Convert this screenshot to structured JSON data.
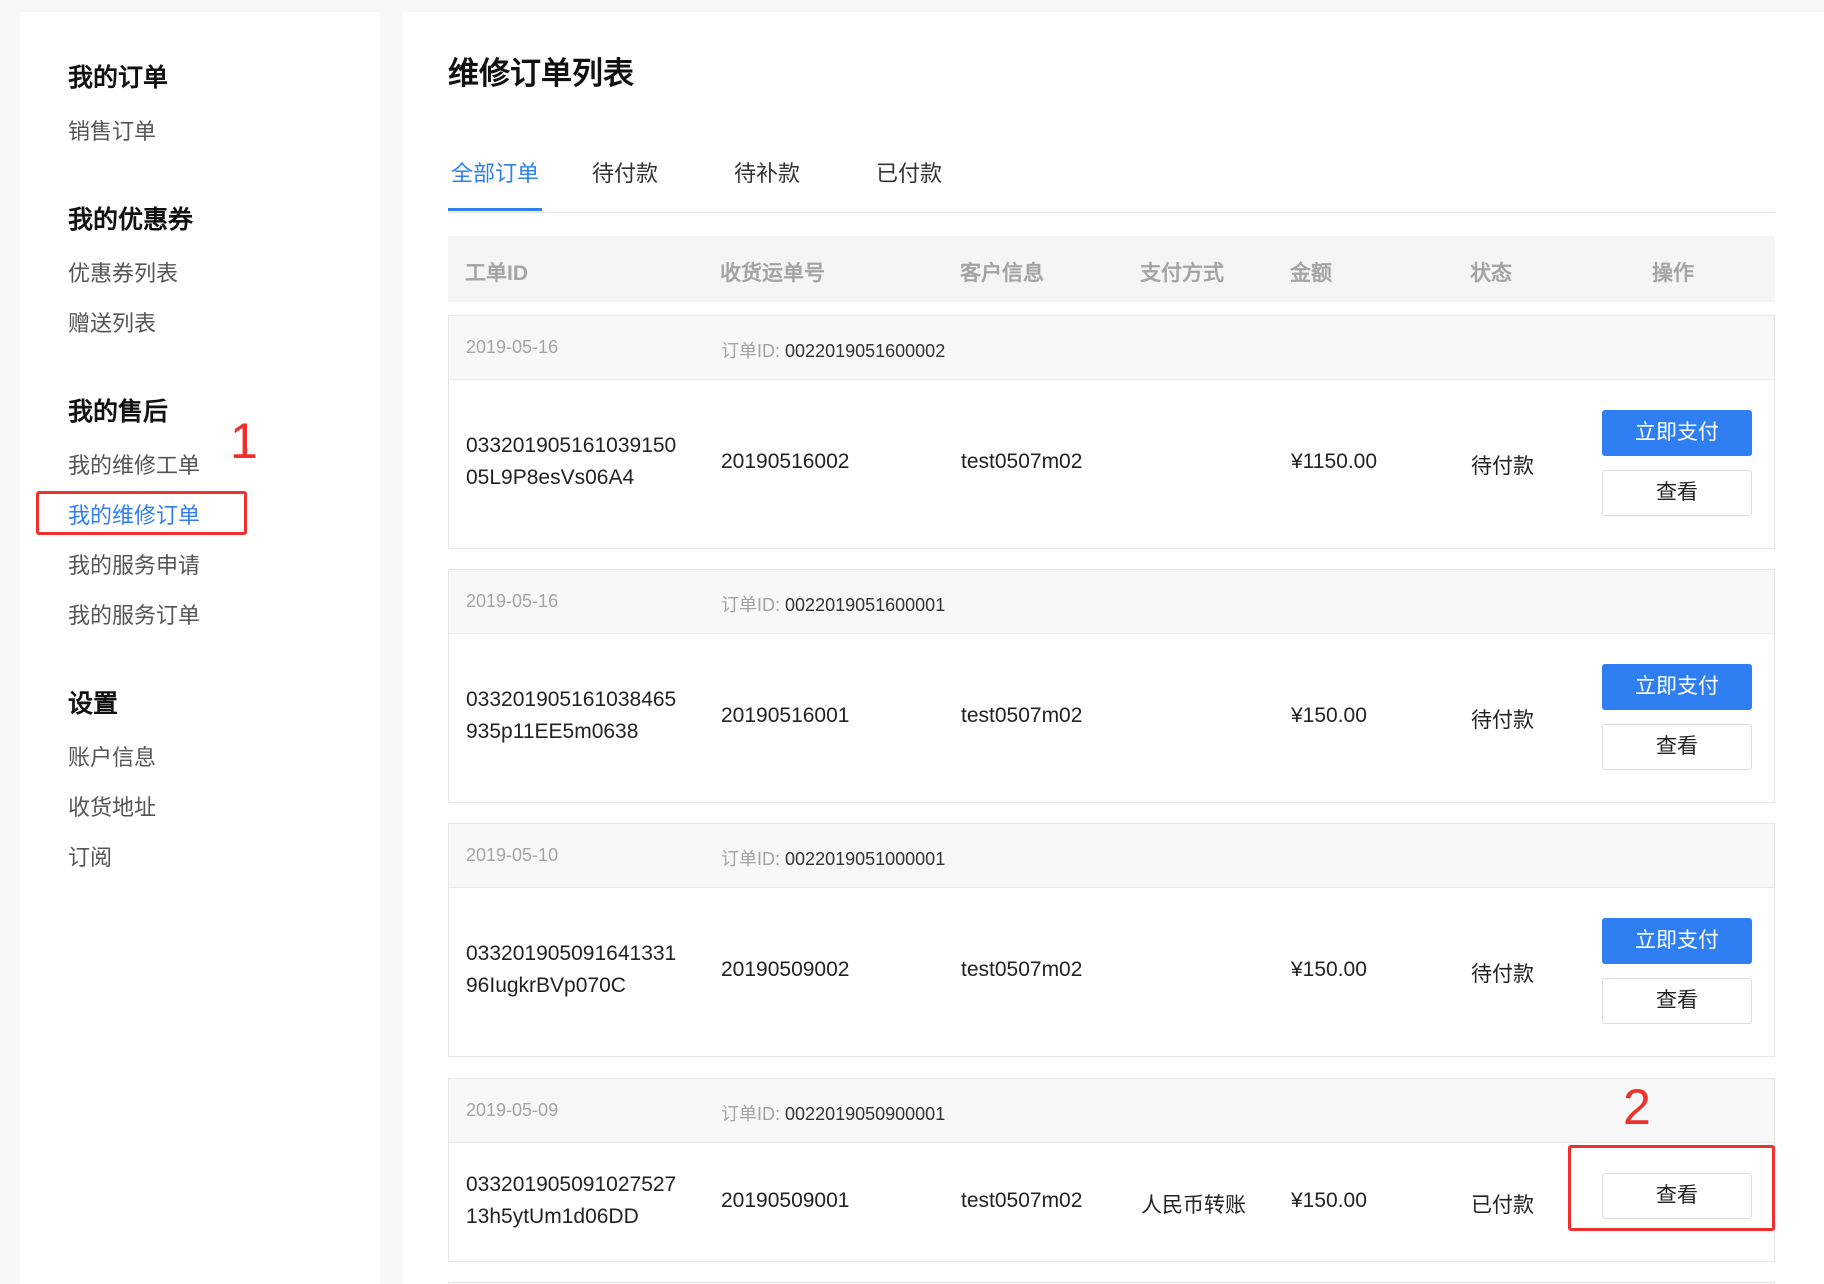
{
  "sidebar": {
    "groups": [
      {
        "title": "我的订单",
        "items": [
          "销售订单"
        ]
      },
      {
        "title": "我的优惠券",
        "items": [
          "优惠券列表",
          "赠送列表"
        ]
      },
      {
        "title": "我的售后",
        "items": [
          "我的维修工单",
          "我的维修订单",
          "我的服务申请",
          "我的服务订单"
        ]
      },
      {
        "title": "设置",
        "items": [
          "账户信息",
          "收货地址",
          "订阅"
        ]
      }
    ],
    "active_item": "我的维修订单"
  },
  "annotations": {
    "one": "1",
    "two": "2"
  },
  "main": {
    "title": "维修订单列表",
    "tabs": [
      "全部订单",
      "待付款",
      "待补款",
      "已付款"
    ],
    "active_tab": "全部订单",
    "columns": [
      "工单ID",
      "收货运单号",
      "客户信息",
      "支付方式",
      "金额",
      "状态",
      "操作"
    ],
    "order_id_label": "订单ID:",
    "pay_label": "立即支付",
    "view_label": "查看",
    "orders": [
      {
        "date": "2019-05-16",
        "order_id": "0022019051600002",
        "ticket_line1": "033201905161039150",
        "ticket_line2": "05L9P8esVs06A4",
        "tracking": "20190516002",
        "customer": "test0507m02",
        "payment": "",
        "amount": "¥1150.00",
        "status": "待付款"
      },
      {
        "date": "2019-05-16",
        "order_id": "0022019051600001",
        "ticket_line1": "033201905161038465",
        "ticket_line2": "935p11EE5m0638",
        "tracking": "20190516001",
        "customer": "test0507m02",
        "payment": "",
        "amount": "¥150.00",
        "status": "待付款"
      },
      {
        "date": "2019-05-10",
        "order_id": "0022019051000001",
        "ticket_line1": "033201905091641331",
        "ticket_line2": "96IugkrBVp070C",
        "tracking": "20190509002",
        "customer": "test0507m02",
        "payment": "",
        "amount": "¥150.00",
        "status": "待付款"
      },
      {
        "date": "2019-05-09",
        "order_id": "0022019050900001",
        "ticket_line1": "033201905091027527",
        "ticket_line2": "13h5ytUm1d06DD",
        "tracking": "20190509001",
        "customer": "test0507m02",
        "payment": "人民币转账",
        "amount": "¥150.00",
        "status": "已付款"
      }
    ]
  }
}
